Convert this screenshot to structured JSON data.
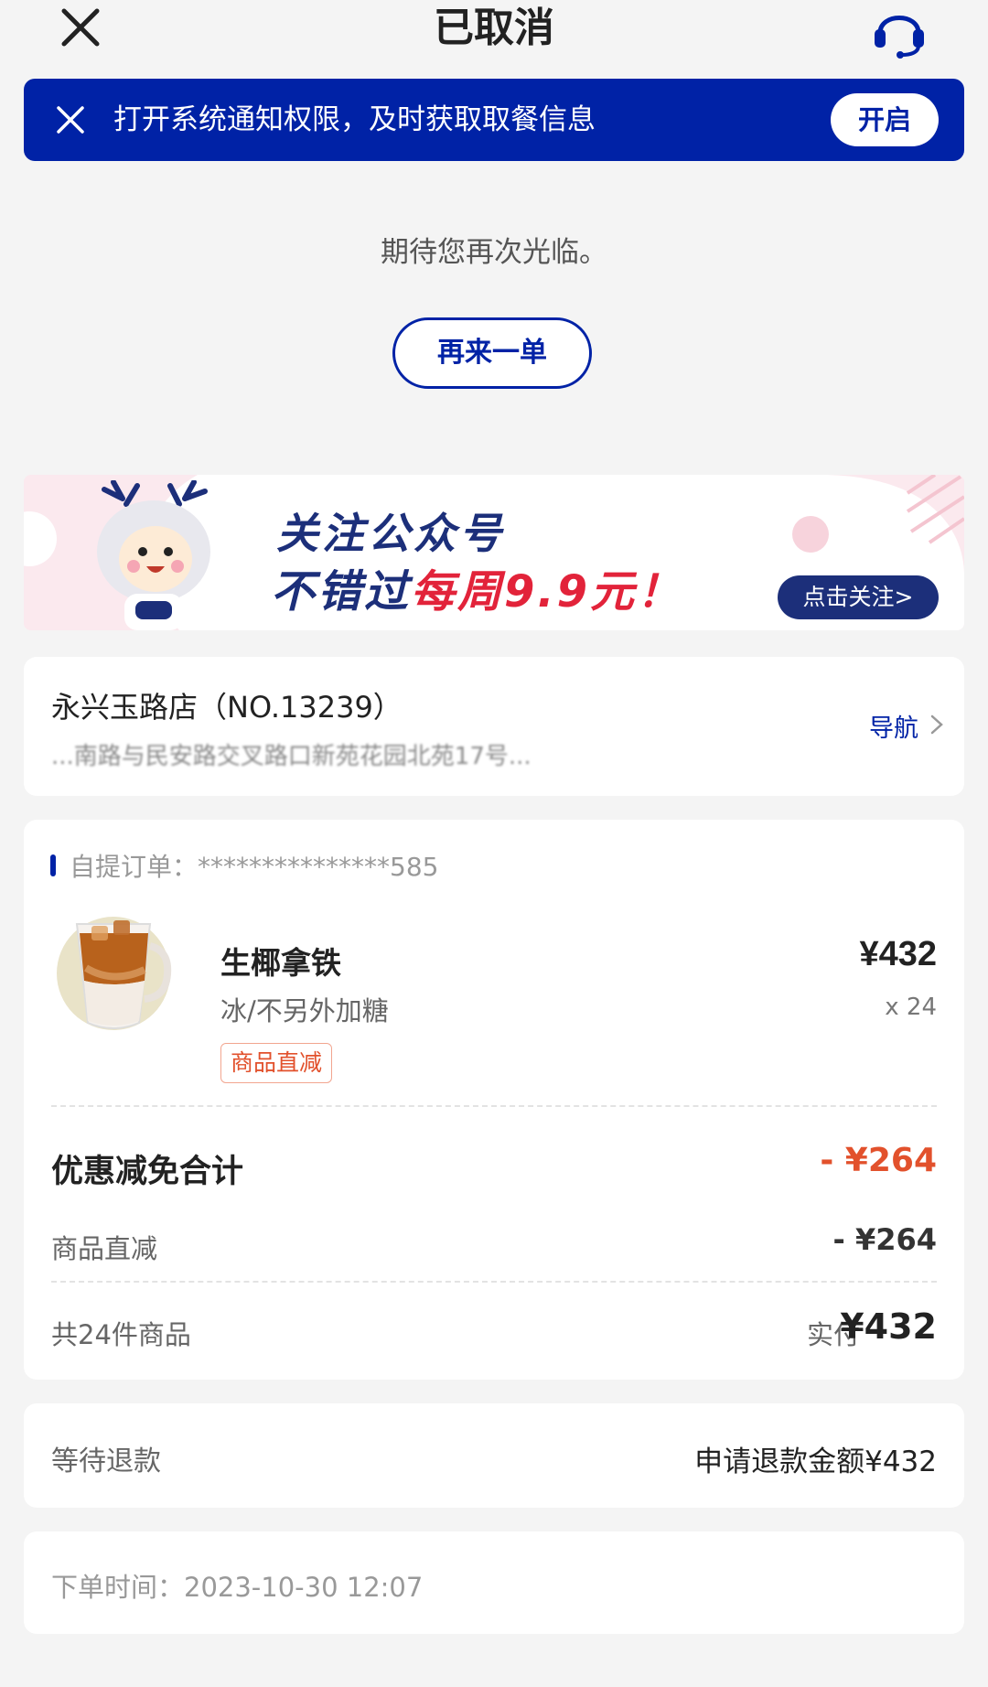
{
  "header": {
    "title": "已取消",
    "close_icon": "close-icon",
    "support_icon": "headset-icon"
  },
  "notice": {
    "text": "打开系统通知权限，及时获取取餐信息",
    "button": "开启",
    "close_icon": "close-icon",
    "color": "#0022a6"
  },
  "thanks_text": "期待您再次光临。",
  "reorder_button": "再来一单",
  "banner": {
    "line1": "关注公众号",
    "line2_prefix": "不错过",
    "line2_highlight": "每周9.9元！",
    "cta": "点击关注>",
    "mascot_icon": "deer-mascot-icon"
  },
  "store": {
    "name": "永兴玉路店（NO.13239）",
    "address": "...南路与民安路交叉路口新苑花园北苑17号...",
    "nav_label": "导航"
  },
  "order": {
    "label": "自提订单：",
    "number": "***************585",
    "product": {
      "name": "生椰拿铁",
      "spec": "冰/不另外加糖",
      "tag": "商品直减",
      "price": "¥432",
      "quantity": "x 24"
    },
    "discount_total_label": "优惠减免合计",
    "discount_total_value": "- ¥264",
    "discount_item_label": "商品直减",
    "discount_item_value": "- ¥264",
    "item_count": "共24件商品",
    "paid_label": "实付",
    "paid_value": "¥432"
  },
  "refund": {
    "status": "等待退款",
    "amount": "申请退款金额¥432"
  },
  "order_time": "下单时间：2023-10-30 12:07",
  "colors": {
    "brand_blue": "#0022a6",
    "discount_red": "#e2512c",
    "background": "#f4f4f4"
  }
}
